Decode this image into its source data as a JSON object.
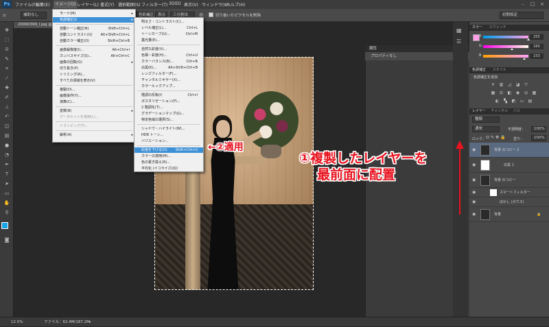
{
  "app": {
    "logo": "Ps"
  },
  "menubar": {
    "items": [
      "ファイル(F)",
      "編集(E)",
      "イメージ(I)",
      "レイヤー(L)",
      "書式(Y)",
      "選択範囲(S)",
      "フィルター(T)",
      "3D(D)",
      "表示(V)",
      "ウィンドウ(W)",
      "ヘルプ(H)"
    ],
    "window_buttons": [
      "–",
      "□",
      "×"
    ]
  },
  "options_bar": {
    "feather": "補助なし",
    "color_correction": "色彩補正",
    "view": "表示",
    "three_layer": "三分割法",
    "checkbox_label": "切り抜いたピクセルを削除",
    "workspace": "初期設定"
  },
  "document": {
    "tab": "20060399_l.jpg @ 1C"
  },
  "image_menu": {
    "items": [
      {
        "label": "モード(M)",
        "shortcut": "",
        "arrow": "▸"
      },
      {
        "label": "色調補正(J)",
        "shortcut": "",
        "arrow": "▸",
        "highlighted": true
      },
      {
        "label": "自動トーン補正(N)",
        "shortcut": "Shift+Ctrl+L"
      },
      {
        "label": "自動コントラスト(U)",
        "shortcut": "Alt+Shift+Ctrl+L"
      },
      {
        "label": "自動カラー補正(O)",
        "shortcut": "Shift+Ctrl+B"
      },
      {
        "label": "画像解像度(I)...",
        "shortcut": "Alt+Ctrl+I"
      },
      {
        "label": "カンバスサイズ(S)...",
        "shortcut": "Alt+Ctrl+C"
      },
      {
        "label": "画像の回転(G)",
        "shortcut": "",
        "arrow": "▸"
      },
      {
        "label": "切り抜き(P)",
        "shortcut": ""
      },
      {
        "label": "トリミング(R)...",
        "shortcut": ""
      },
      {
        "label": "すべての領域を表示(V)",
        "shortcut": ""
      },
      {
        "label": "複製(D)...",
        "shortcut": ""
      },
      {
        "label": "画像操作(Y)...",
        "shortcut": ""
      },
      {
        "label": "演算(C)...",
        "shortcut": ""
      },
      {
        "label": "変数(B)",
        "shortcut": "",
        "arrow": "▸"
      },
      {
        "label": "データセットを適用(L)...",
        "shortcut": "",
        "disabled": true
      },
      {
        "label": "トラッピング(T)...",
        "shortcut": "",
        "disabled": true
      },
      {
        "label": "解析(A)",
        "shortcut": "",
        "arrow": "▸"
      }
    ]
  },
  "adjust_menu": {
    "items": [
      {
        "label": "明るさ・コントラスト(C)...",
        "shortcut": ""
      },
      {
        "label": "レベル補正(L)...",
        "shortcut": "Ctrl+L"
      },
      {
        "label": "トーンカーブ(U)...",
        "shortcut": "Ctrl+M"
      },
      {
        "label": "露光量(E)...",
        "shortcut": ""
      },
      {
        "label": "自然な彩度(V)...",
        "shortcut": ""
      },
      {
        "label": "色相・彩度(H)...",
        "shortcut": "Ctrl+U"
      },
      {
        "label": "カラーバランス(B)...",
        "shortcut": "Ctrl+B"
      },
      {
        "label": "白黒(K)...",
        "shortcut": "Alt+Shift+Ctrl+B"
      },
      {
        "label": "レンズフィルター(F)...",
        "shortcut": ""
      },
      {
        "label": "チャンネルミキサー(X)...",
        "shortcut": ""
      },
      {
        "label": "カラールックアップ...",
        "shortcut": ""
      },
      {
        "label": "階調の反転(I)",
        "shortcut": "Ctrl+I"
      },
      {
        "label": "ポスタリゼーション(P)...",
        "shortcut": ""
      },
      {
        "label": "2 階調化(T)...",
        "shortcut": ""
      },
      {
        "label": "グラデーションマップ(G)...",
        "shortcut": ""
      },
      {
        "label": "特定色域の選択(S)...",
        "shortcut": ""
      },
      {
        "label": "シャドウ・ハイライト(W)...",
        "shortcut": ""
      },
      {
        "label": "HDR トーン...",
        "shortcut": ""
      },
      {
        "label": "バリエーション...",
        "shortcut": ""
      },
      {
        "label": "彩度を下げる(D)",
        "shortcut": "Shift+Ctrl+U",
        "highlighted": true
      },
      {
        "label": "カラーの適用(M)...",
        "shortcut": ""
      },
      {
        "label": "色の置き換え(R)...",
        "shortcut": ""
      },
      {
        "label": "平均化 (イコライズ)(Q)",
        "shortcut": ""
      }
    ]
  },
  "properties": {
    "title": "属性",
    "body": "プロパティなし"
  },
  "color_panel": {
    "tabs": [
      "カラー",
      "スウォッチ"
    ],
    "rows": [
      {
        "label": "R",
        "value": "255",
        "percent": 100
      },
      {
        "label": "G",
        "value": "160",
        "percent": 63
      },
      {
        "label": "B",
        "value": "233",
        "percent": 91
      }
    ]
  },
  "adjust_panel": {
    "tabs": [
      "色調補正",
      "スタイル"
    ],
    "hint": "色調補正を追加"
  },
  "layers_panel": {
    "tabs": [
      "レイヤー",
      "チャンネル",
      "パス"
    ],
    "kind": "種類",
    "blend": "通常",
    "opacity_label": "不透明度：",
    "opacity": "100%",
    "lock_label": "ロック：",
    "fill_label": "塗り：",
    "fill": "100%",
    "layers": [
      {
        "name": "背景 のコピー 2"
      },
      {
        "name": "白黒 1"
      },
      {
        "name": "背景 のコピー"
      },
      {
        "name": "スマートフィルター"
      },
      {
        "name": "ぼかし (ガウス)"
      },
      {
        "name": "背景"
      }
    ]
  },
  "status": {
    "zoom": "12.5%",
    "file": "ファイル：62.4M/187.2M",
    "tabs": [
      "Mini Bridge",
      "タイムライン"
    ]
  },
  "annotations": {
    "apply": "←②適用",
    "duplicate_line1": "①複製したレイヤーを",
    "duplicate_line2": "最前面に配置"
  },
  "colors": {
    "annotation": "#e8131f",
    "highlight": "#3d8fd6",
    "arrow": "#e8131f"
  }
}
